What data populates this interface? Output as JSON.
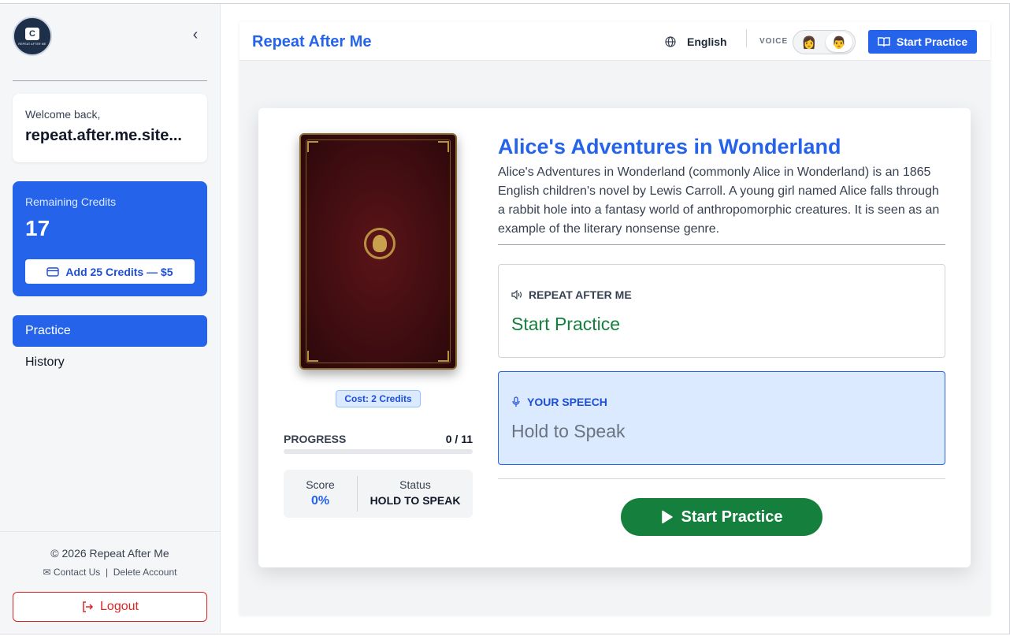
{
  "sidebar": {
    "logo_caption": "REPEAT AFTER ME",
    "welcome_label": "Welcome back,",
    "username": "repeat.after.me.site...",
    "credits_label": "Remaining Credits",
    "credits_value": "17",
    "add_credits_label": "Add 25 Credits — $5",
    "nav": [
      {
        "label": "Practice",
        "active": true
      },
      {
        "label": "History",
        "active": false
      }
    ],
    "copyright": "© 2026 Repeat After Me",
    "contact_label": "Contact Us",
    "delete_label": "Delete Account",
    "logout_label": "Logout"
  },
  "header": {
    "title": "Repeat After Me",
    "language": "English",
    "voice_label": "VOICE",
    "voice_options": [
      "female-voice-icon",
      "male-voice-icon"
    ],
    "voice_selected": "male-voice-icon",
    "start_label": "Start Practice"
  },
  "book": {
    "title": "Alice's Adventures in Wonderland",
    "description": "Alice's Adventures in Wonderland (commonly Alice in Wonderland) is an 1865 English children's novel by Lewis Carroll. A young girl named Alice falls through a rabbit hole into a fantasy world of anthropomorphic creatures. It is seen as an example of the literary nonsense genre.",
    "cost": "Cost: 2 Credits"
  },
  "progress": {
    "label": "PROGRESS",
    "value": "0 / 11",
    "fraction": 0
  },
  "stats": {
    "score_label": "Score",
    "score_value": "0%",
    "status_label": "Status",
    "status_value": "HOLD TO SPEAK"
  },
  "repeat_box": {
    "header": "REPEAT AFTER ME",
    "body": "Start Practice"
  },
  "speech_box": {
    "header": "YOUR SPEECH",
    "body": "Hold to Speak"
  },
  "main_button": {
    "label": "Start Practice"
  },
  "colors": {
    "accent": "#2563eb",
    "success": "#15803d",
    "danger": "#dc2626"
  }
}
